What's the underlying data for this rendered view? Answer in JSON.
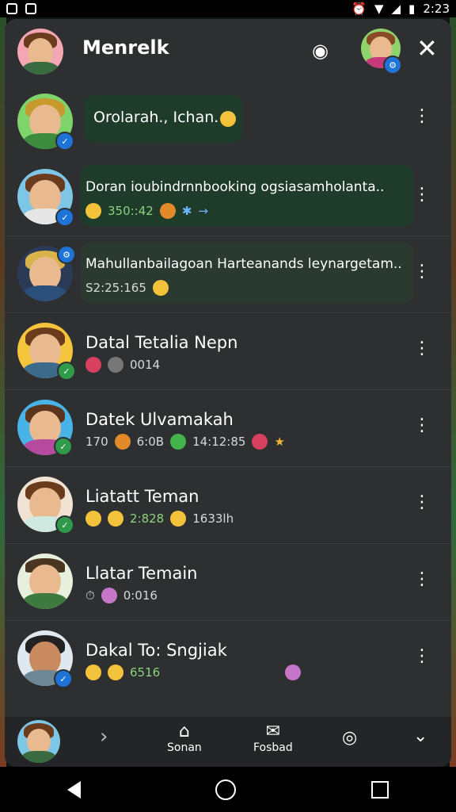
{
  "statusbar": {
    "time": "2:23"
  },
  "header": {
    "title": "Menrelk"
  },
  "chats": [
    {
      "text": "Orolarah., Ichan.",
      "sub": ""
    },
    {
      "name": "Doran ioubindrnnbooking ogsiasamholanta..",
      "time": "350::42"
    },
    {
      "name": "Mahullanbailagoan Harteanands leynargetam..",
      "time": "S2:25:165"
    },
    {
      "name": "Datal Tetalia Nepn",
      "sub": "0014"
    },
    {
      "name": "Datek Ulvamakah",
      "sub1": "170",
      "sub2": "6:0B",
      "sub3": "14:12:85"
    },
    {
      "name": "Liatatt Teman",
      "sub1": "2:828",
      "sub2": "1633lh"
    },
    {
      "name": "Llatar Temain",
      "sub": "0:016"
    },
    {
      "name": "Dakal To: Sngjiak",
      "sub": "6516"
    }
  ],
  "bottom_bar": {
    "tabs": [
      {
        "label": "Sonan"
      },
      {
        "label": "Fosbad"
      }
    ]
  }
}
